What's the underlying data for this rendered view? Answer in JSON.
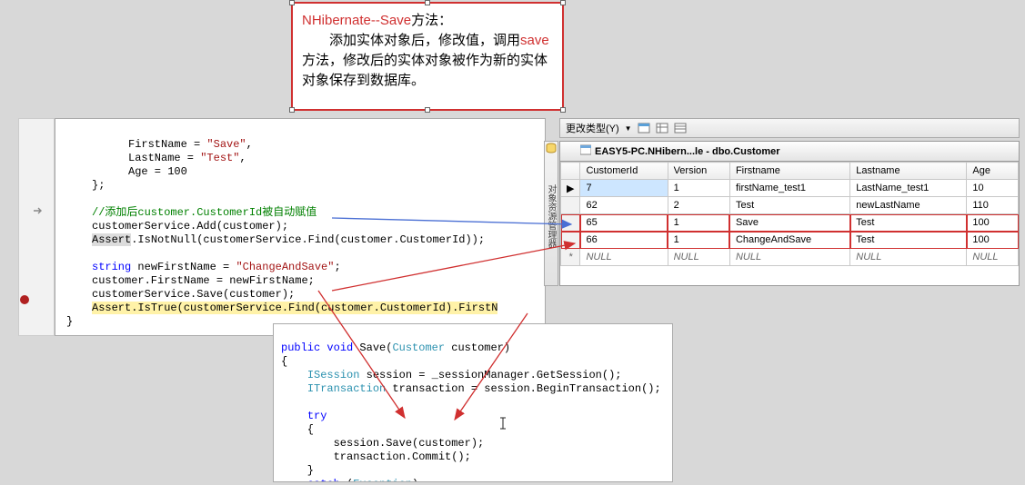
{
  "annotation": {
    "title_prefix": "NHibernate--Save",
    "title_suffix": "方法：",
    "body_indent": "　　添加实体对象后，修改值，调用",
    "body_save": "save",
    "body_rest": "方法，修改后的实体对象被作为新的实体对象保存到数据库。"
  },
  "code": {
    "l1a": "FirstName = ",
    "l1b": "\"Save\"",
    "l1c": ",",
    "l2a": "LastName = ",
    "l2b": "\"Test\"",
    "l2c": ",",
    "l3a": "Age = 100",
    "l4": "};",
    "l5cmt": "//添加后customer.CustomerId被自动赋值",
    "l6": "customerService.Add(customer);",
    "l7a": "Assert",
    "l7b": ".IsNotNull(customerService.Find(customer.CustomerId));",
    "l8a": "string",
    "l8b": " newFirstName = ",
    "l8c": "\"ChangeAndSave\"",
    "l8d": ";",
    "l9": "customer.FirstName = newFirstName;",
    "l10": "customerService.Save(customer);",
    "l11a": "Assert",
    "l11b": ".IsTrue(customerService.Find(customer.CustomerId).FirstN",
    "l12": "}"
  },
  "snippet": {
    "s1a": "public",
    "s1b": " void",
    "s1c": " Save(",
    "s1d": "Customer",
    "s1e": " customer)",
    "s2": "{",
    "s3a": "    ",
    "s3b": "ISession",
    "s3c": " session = _sessionManager.GetSession();",
    "s4a": "    ",
    "s4b": "ITransaction",
    "s4c": " transaction = session.BeginTransaction();",
    "s5a": "    ",
    "s5b": "try",
    "s6": "    {",
    "s7": "        session.Save(customer);",
    "s8": "        transaction.Commit();",
    "s9": "    }",
    "s10a": "    ",
    "s10b": "catch",
    "s10c": " (",
    "s10d": "Exception",
    "s10e": ")"
  },
  "toolbar": {
    "change_type": "更改类型(Y)"
  },
  "data_panel": {
    "tab_title": "EASY5-PC.NHibern...le - dbo.Customer",
    "cols": [
      "CustomerId",
      "Version",
      "Firstname",
      "Lastname",
      "Age"
    ],
    "rows": [
      {
        "ptr": "▶",
        "id": "7",
        "ver": "1",
        "fn": "firstName_test1",
        "ln": "LastName_test1",
        "age": "10",
        "sel": true
      },
      {
        "ptr": "",
        "id": "62",
        "ver": "2",
        "fn": "Test",
        "ln": "newLastName",
        "age": "110"
      },
      {
        "ptr": "",
        "id": "65",
        "ver": "1",
        "fn": "Save",
        "ln": "Test",
        "age": "100",
        "hl": true
      },
      {
        "ptr": "",
        "id": "66",
        "ver": "1",
        "fn": "ChangeAndSave",
        "ln": "Test",
        "age": "100",
        "hl": true
      },
      {
        "ptr": "*",
        "id": "NULL",
        "ver": "NULL",
        "fn": "NULL",
        "ln": "NULL",
        "age": "NULL",
        "null": true
      }
    ]
  },
  "side_label": "对象资源管理器"
}
